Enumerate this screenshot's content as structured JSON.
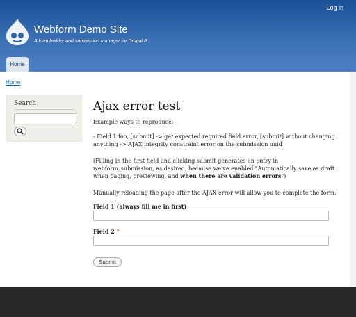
{
  "header": {
    "user_link": "Log in",
    "site_name": "Webform Demo Site",
    "site_slogan": "A form builder and submission manager for Drupal 8.",
    "logo_icon": "drupal-drop-icon",
    "tabs": [
      {
        "label": "Home"
      }
    ]
  },
  "breadcrumb": {
    "home": "Home"
  },
  "sidebar": {
    "search_title": "Search",
    "search_input_value": "",
    "search_button_icon": "magnifier-icon"
  },
  "main": {
    "title": "Ajax error test",
    "intro": "Example ways to reproduce:",
    "step1": "- Field 1 foo, [submit] -> get expected required field error, [submit] without changing anything -> AJAX integrity constraint error on the submission uuid",
    "step2_normal": "(Filling in the first field and clicking submit generates an entry in webform_submission, as desired, because we've enabled \"Automatically save as draft when paging, previewing, and ",
    "step2_bold": "when there are validation errors",
    "step2_end": "\")",
    "step3": "Manually reloading the page after the AJAX error will allow you to complete the form.",
    "field1_label": "Field 1 (always fill me in first)",
    "field1_value": "",
    "field2_label": "Field 2",
    "field2_required": "*",
    "field2_value": "",
    "submit_label": "Submit"
  },
  "colors": {
    "header_top": "#1a5096",
    "header_bottom": "#4d80c2",
    "link": "#0071b3",
    "required": "#e32700",
    "footer": "#292929"
  }
}
